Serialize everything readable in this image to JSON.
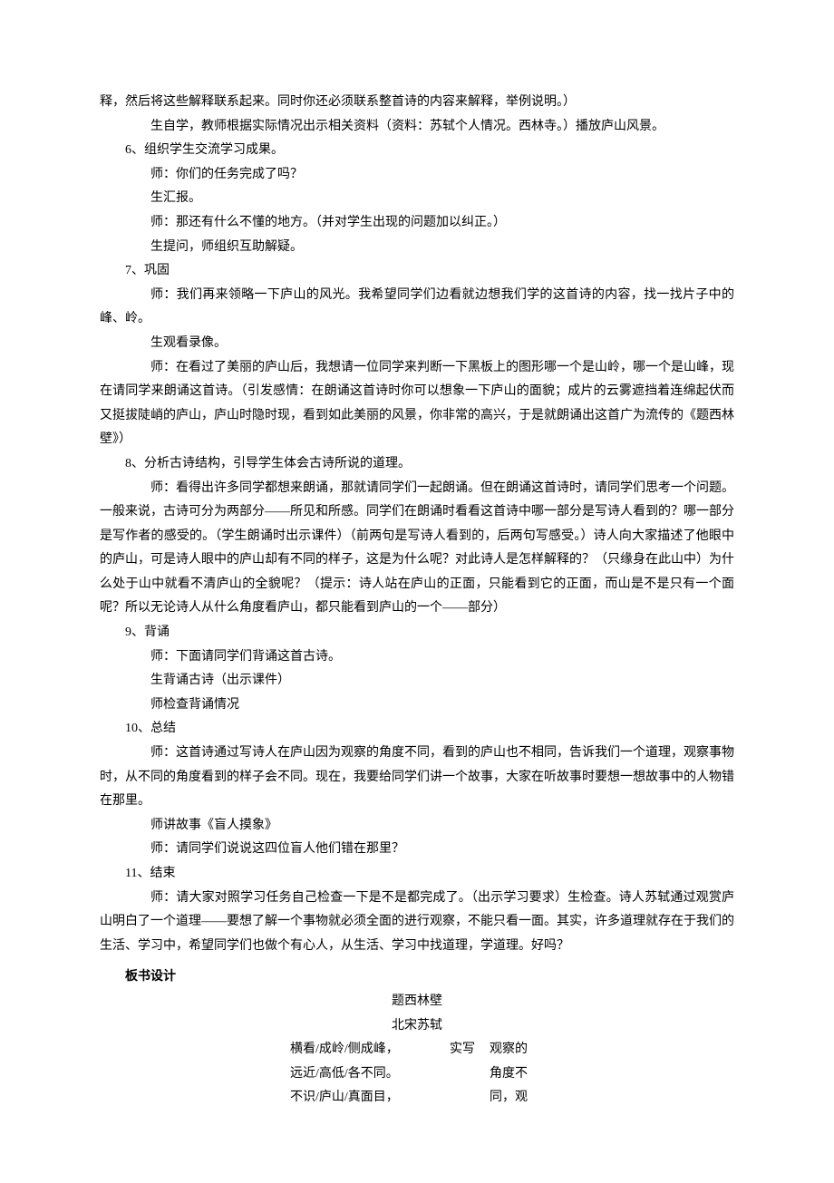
{
  "intro_cont": "释，然后将这些解释联系起来。同时你还必须联系整首诗的内容来解释，举例说明。）",
  "intro_sub": "生自学，教师根据实际情况出示相关资料（资料：苏轼个人情况。西林寺。）播放庐山风景。",
  "s6": {
    "title": "6、组织学生交流学习成果。",
    "lines": [
      "师：你们的任务完成了吗？",
      "生汇报。",
      "师：那还有什么不懂的地方。（并对学生出现的问题加以纠正。）",
      "生提问，师组织互助解疑。"
    ]
  },
  "s7": {
    "title": "7、巩固",
    "p1": "师：我们再来领略一下庐山的风光。我希望同学们边看就边想我们学的这首诗的内容，找一找片子中的峰、岭。",
    "p2": "生观看录像。",
    "p3": "师：在看过了美丽的庐山后，我想请一位同学来判断一下黑板上的图形哪一个是山岭，哪一个是山峰，现在请同学来朗诵这首诗。（引发感情：在朗诵这首诗时你可以想象一下庐山的面貌；成片的云雾遮挡着连绵起伏而又挺拔陡峭的庐山，庐山时隐时现，看到如此美丽的风景，你非常的高兴，于是就朗诵出这首广为流传的《题西林壁》）"
  },
  "s8": {
    "title": "8、分析古诗结构，引导学生体会古诗所说的道理。",
    "p1": "师：看得出许多同学都想来朗诵，那就请同学们一起朗诵。但在朗诵这首诗时，请同学们思考一个问题。一般来说，古诗可分为两部分——所见和所感。同学们在朗诵时看看这首诗中哪一部分是写诗人看到的？哪一部分是写作者的感受的。（学生朗诵时出示课件）（前两句是写诗人看到的，后两句写感受。）诗人向大家描述了他眼中的庐山，可是诗人眼中的庐山却有不同的样子，这是为什么呢？对此诗人是怎样解释的？（只缘身在此山中）为什么处于山中就看不清庐山的全貌呢？（提示：诗人站在庐山的正面，只能看到它的正面，而山是不是只有一个面呢？所以无论诗人从什么角度看庐山，都只能看到庐山的一个——部分）"
  },
  "s9": {
    "title": "9、背诵",
    "lines": [
      "师：下面请同学们背诵这首古诗。",
      "生背诵古诗（出示课件）",
      "师检查背诵情况"
    ]
  },
  "s10": {
    "title": "10、总结",
    "p1": "师：这首诗通过写诗人在庐山因为观察的角度不同，看到的庐山也不相同，告诉我们一个道理，观察事物时，从不同的角度看到的样子会不同。现在，我要给同学们讲一个故事，大家在听故事时要想一想故事中的人物错在那里。",
    "p2": "师讲故事《盲人摸象》",
    "p3": "师：请同学们说说这四位盲人他们错在那里？"
  },
  "s11": {
    "title": "11、结束",
    "p1": "师：请大家对照学习任务自己检查一下是不是都完成了。（出示学习要求）生检查。诗人苏轼通过观赏庐山明白了一个道理——要想了解一个事物就必须全面的进行观察，不能只看一面。其实，许多道理就存在于我们的生活、学习中，希望同学们也做个有心人，从生活、学习中找道理，学道理。好吗？"
  },
  "board": {
    "header": "板书设计",
    "title": "题西林壁",
    "author": "北宋苏轼",
    "left": [
      "横看/成岭/侧成峰，",
      "远近/高低/各不同。",
      "不识/庐山/真面目，"
    ],
    "mid_blank": "",
    "mid": "实写",
    "right": [
      "观察的",
      "角度不",
      "同，观"
    ]
  }
}
